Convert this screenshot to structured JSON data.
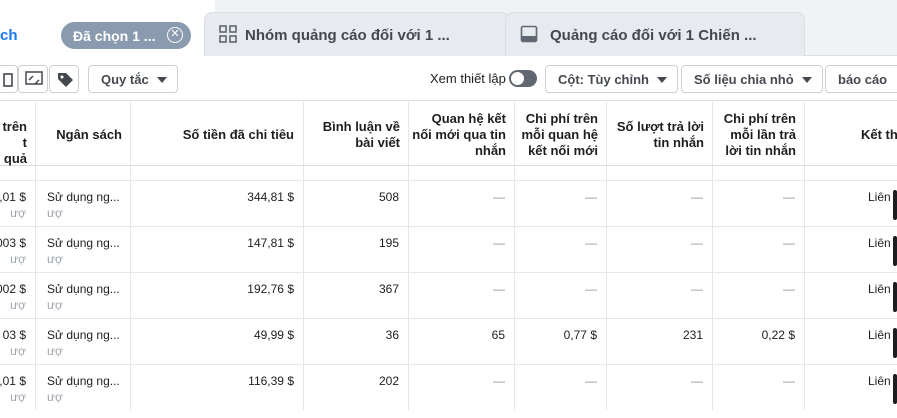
{
  "tabs": {
    "campaign_label": "ch",
    "selected_chip": "Đã chọn 1 ...",
    "adsets_label": "Nhóm quảng cáo đối với 1 ...",
    "ads_label": "Quảng cáo đối với 1 Chiến ..."
  },
  "toolbar": {
    "rules_label": "Quy tắc",
    "view_setup_label": "Xem thiết lập",
    "columns_label": "Cột: Tùy chỉnh",
    "breakdown_label": "Số liệu chia nhỏ",
    "reports_label": "báo cáo"
  },
  "headers": {
    "col0_l1": "trên",
    "col0_l2": "t quả",
    "budget": "Ngân sách",
    "spent": "Số tiền đã chi tiêu",
    "comments_l1": "Bình luận về",
    "comments_l2": "bài viết",
    "new_conn_l1": "Quan hệ kết",
    "new_conn_l2": "nối mới qua tin",
    "new_conn_l3": "nhắn",
    "cost_conn_l1": "Chi phí trên",
    "cost_conn_l2": "mỗi quan hệ",
    "cost_conn_l3": "kết nối mới",
    "replies_l1": "Số lượt trả lời",
    "replies_l2": "tin nhắn",
    "cost_reply_l1": "Chi phí trên",
    "cost_reply_l2": "mỗi lần trả",
    "cost_reply_l3": "lời tin nhắn",
    "result": "Kết thú"
  },
  "rows": [
    {
      "c0": ",01 $",
      "c0sub": "ượ",
      "budget": "Sử dụng ng...",
      "budget_sub": "ượ",
      "spent": "344,81 $",
      "comments": "508",
      "new_conn": "—",
      "cost_conn": "—",
      "replies": "—",
      "cost_reply": "—",
      "result": "Liên"
    },
    {
      "c0": "003 $",
      "c0sub": "ượ",
      "budget": "Sử dụng ng...",
      "budget_sub": "ượ",
      "spent": "147,81 $",
      "comments": "195",
      "new_conn": "—",
      "cost_conn": "—",
      "replies": "—",
      "cost_reply": "—",
      "result": "Liên"
    },
    {
      "c0": "002 $",
      "c0sub": "ượ",
      "budget": "Sử dụng ng...",
      "budget_sub": "ượ",
      "spent": "192,76 $",
      "comments": "367",
      "new_conn": "—",
      "cost_conn": "—",
      "replies": "—",
      "cost_reply": "—",
      "result": "Liên"
    },
    {
      "c0": "03 $",
      "c0sub": "ượ",
      "budget": "Sử dụng ng...",
      "budget_sub": "ượ",
      "spent": "49,99 $",
      "comments": "36",
      "new_conn": "65",
      "cost_conn": "0,77 $",
      "replies": "231",
      "cost_reply": "0,22 $",
      "result": "Liên"
    },
    {
      "c0": ",01 $",
      "c0sub": "ượ",
      "budget": "Sử dụng ng...",
      "budget_sub": "ượ",
      "spent": "116,39 $",
      "comments": "202",
      "new_conn": "—",
      "cost_conn": "—",
      "replies": "—",
      "cost_reply": "—",
      "result": "Liên"
    }
  ]
}
